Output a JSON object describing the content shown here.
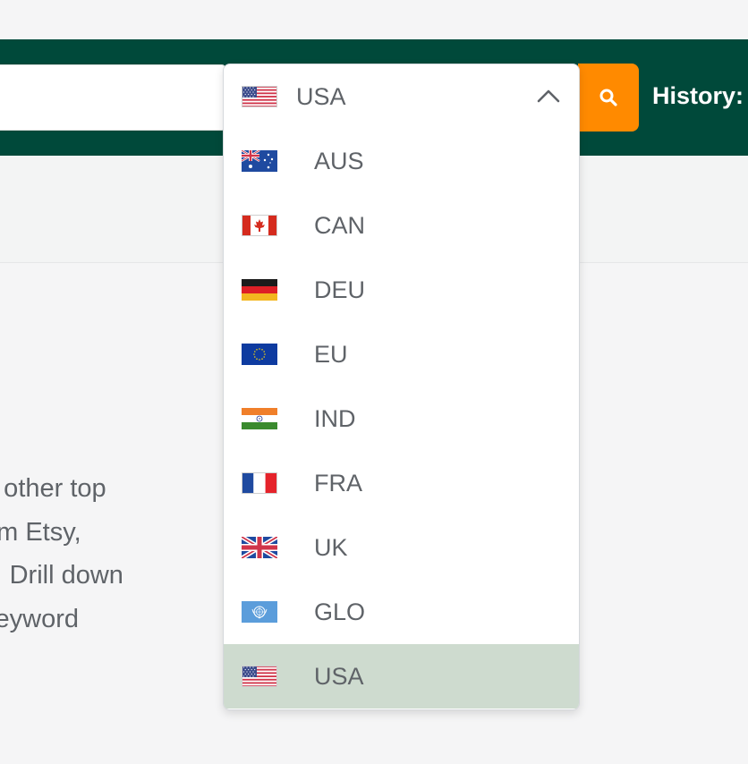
{
  "header": {
    "history_label": "History:",
    "search_icon": "search-icon",
    "search_button_color": "#ff8a00",
    "band_color": "#00493a"
  },
  "dropdown": {
    "selected": {
      "label": "USA",
      "flag": "us-flag-icon"
    },
    "chevron_icon": "chevron-up-icon",
    "options": [
      {
        "label": "AUS",
        "flag": "au-flag-icon"
      },
      {
        "label": "CAN",
        "flag": "ca-flag-icon"
      },
      {
        "label": "DEU",
        "flag": "de-flag-icon"
      },
      {
        "label": "EU",
        "flag": "eu-flag-icon"
      },
      {
        "label": "IND",
        "flag": "in-flag-icon"
      },
      {
        "label": "FRA",
        "flag": "fr-flag-icon"
      },
      {
        "label": "UK",
        "flag": "uk-flag-icon"
      },
      {
        "label": "GLO",
        "flag": "un-flag-icon"
      },
      {
        "label": "USA",
        "flag": "us-flag-icon",
        "highlighted": true
      }
    ],
    "highlight_color": "#cedbcf"
  },
  "body_text": {
    "lines": [
      "n other top",
      "om Etsy,",
      "J. Drill down",
      " keyword"
    ]
  }
}
